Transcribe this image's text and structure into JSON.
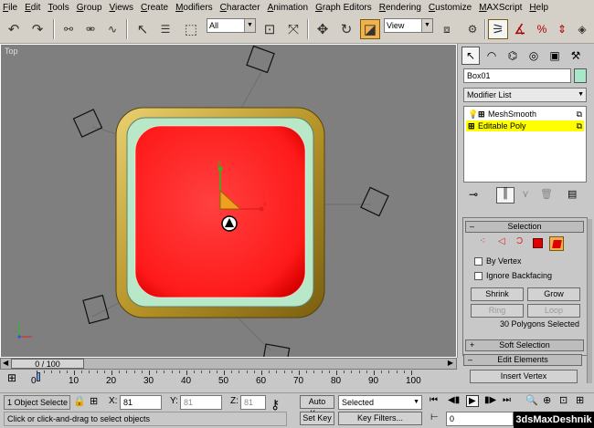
{
  "menu": [
    "File",
    "Edit",
    "Tools",
    "Group",
    "Views",
    "Create",
    "Modifiers",
    "Character",
    "Animation",
    "Graph Editors",
    "Rendering",
    "Customize",
    "MAXScript",
    "Help"
  ],
  "toolbar": {
    "selection_filter": "All",
    "ref_coord": "View"
  },
  "viewport": {
    "label": "Top",
    "gizmo": {
      "y": "y",
      "x": "x"
    }
  },
  "command_panel": {
    "object_name": "Box01",
    "object_color": "#a8e8c8",
    "modifier_list": "Modifier List",
    "stack": [
      {
        "label": "MeshSmooth",
        "selected": false
      },
      {
        "label": "Editable Poly",
        "selected": true
      }
    ],
    "selection": {
      "header": "Selection",
      "by_vertex": "By Vertex",
      "ignore_backfacing": "Ignore Backfacing",
      "shrink": "Shrink",
      "grow": "Grow",
      "ring": "Ring",
      "loop": "Loop",
      "status": "30 Polygons Selected"
    },
    "soft_selection": "Soft Selection",
    "edit_elements": "Edit Elements",
    "insert_vertex": "Insert Vertex"
  },
  "timeline": {
    "frame": "0 / 100",
    "ticks": [
      "0",
      "10",
      "20",
      "30",
      "40",
      "50",
      "60",
      "70",
      "80",
      "90",
      "100"
    ]
  },
  "status": {
    "selected": "1 Object Selecte",
    "hint": "Click or click-and-drag to select objects",
    "x_label": "X:",
    "x_value": "81",
    "y_label": "Y:",
    "y_value": "81",
    "z_label": "Z:",
    "z_value": "81",
    "auto_key": "Auto Key",
    "set_key": "Set Key",
    "key_mode": "Selected",
    "key_filters": "Key Filters...",
    "frame_field": "0"
  },
  "watermark": "3dsMaxDeshnik",
  "colors": {
    "accent": "#f0b24a",
    "selection_red": "#ff1a1a",
    "frame_gold": "#c8a83a",
    "stack_highlight": "#ffff00"
  }
}
